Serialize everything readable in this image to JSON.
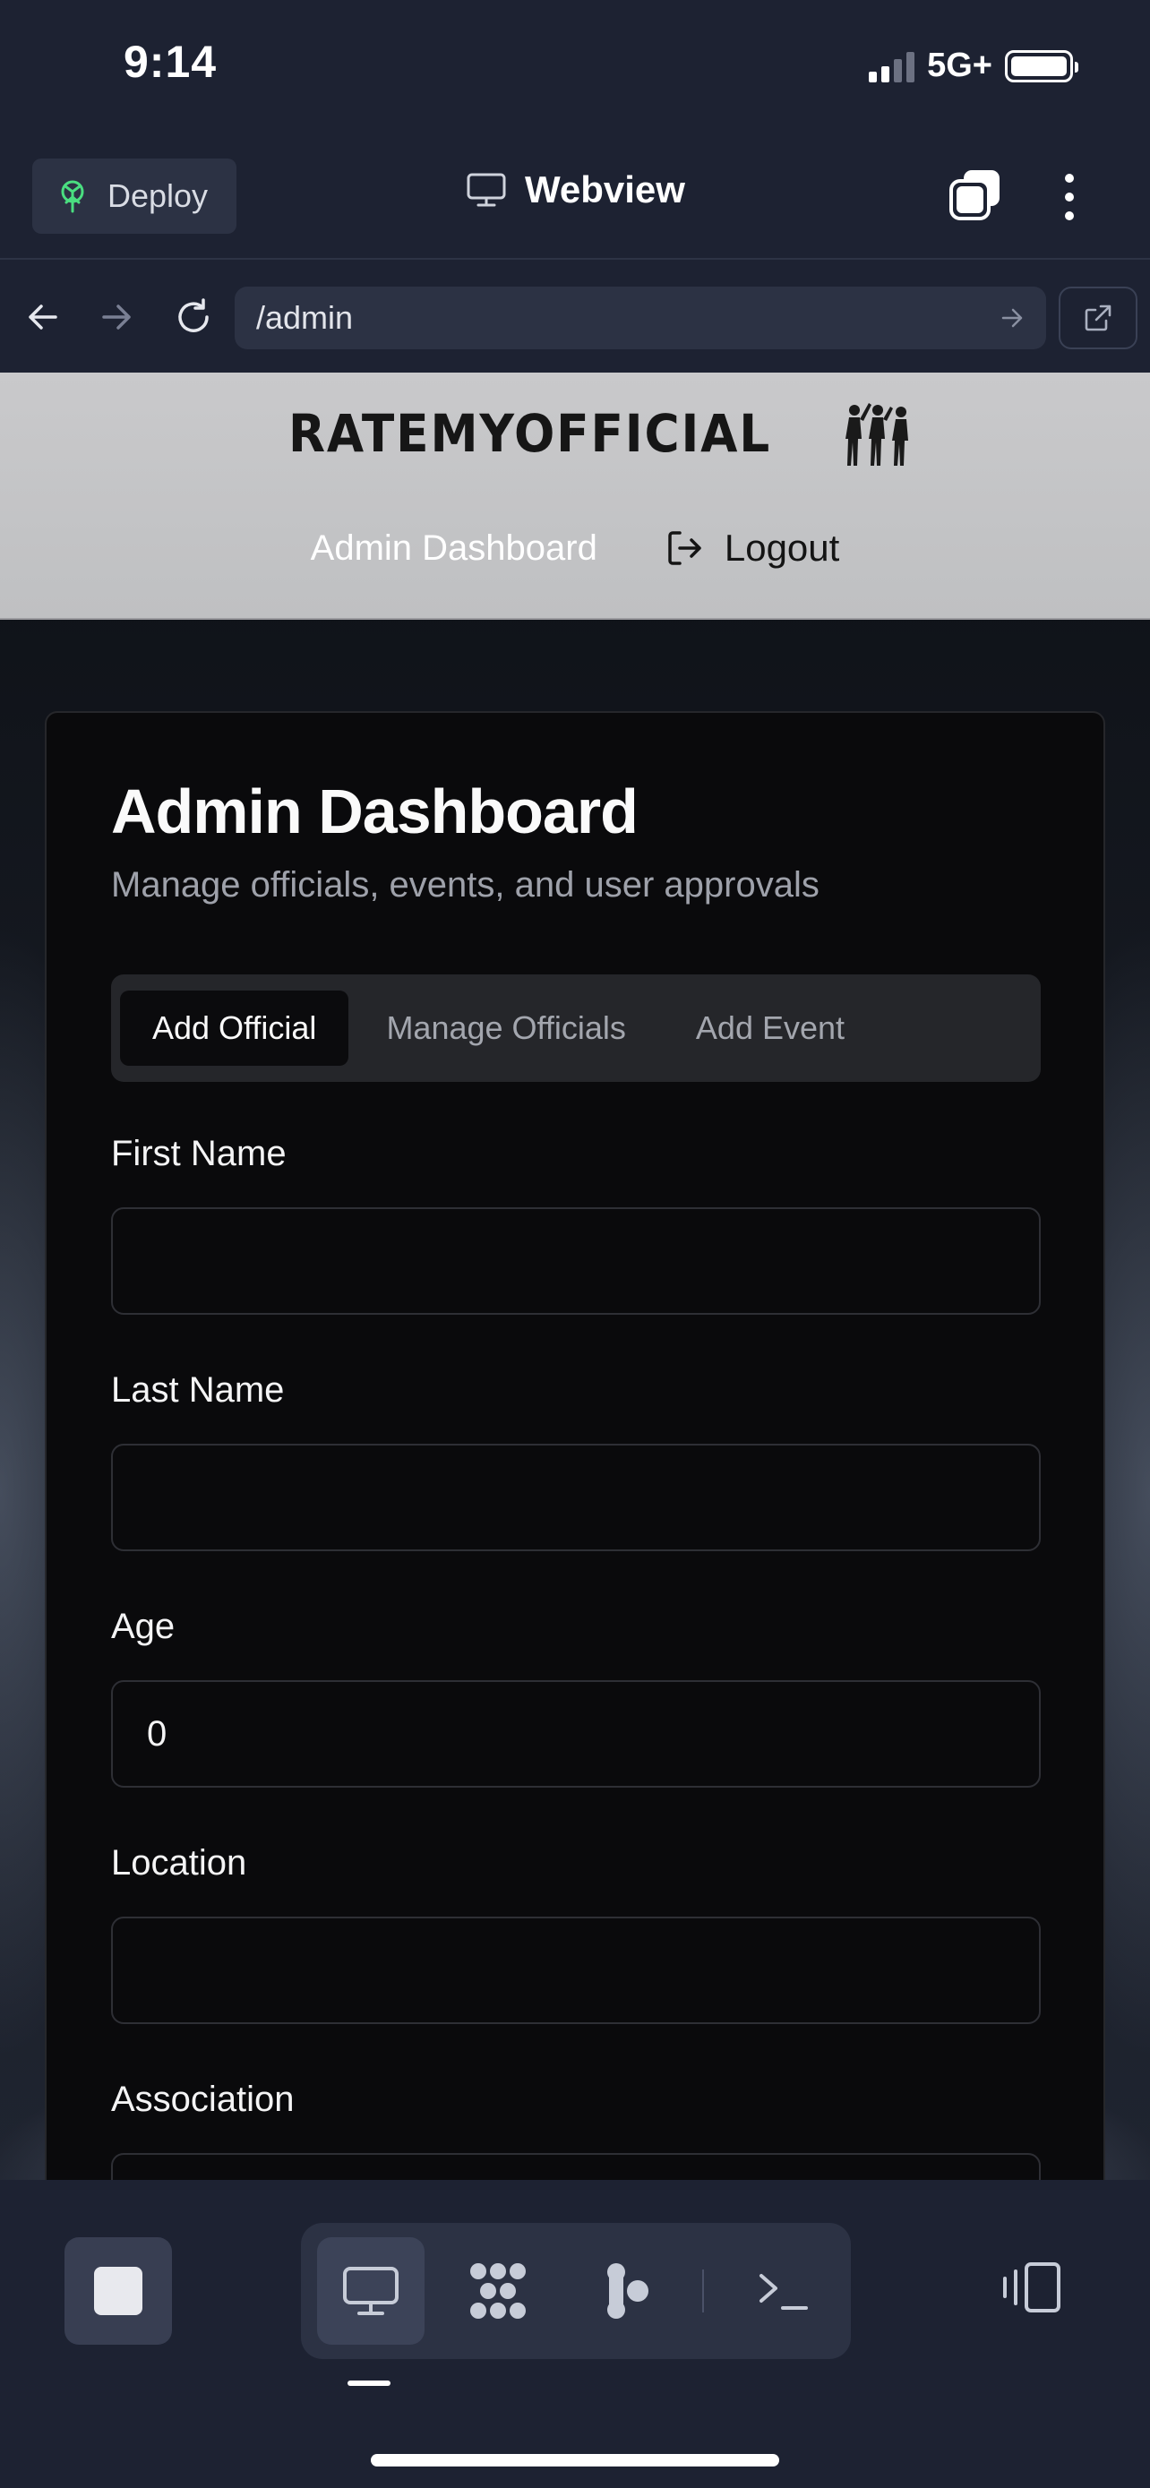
{
  "status_bar": {
    "time": "9:14",
    "network": "5G+"
  },
  "toolbar": {
    "deploy_label": "Deploy",
    "title": "Webview",
    "icons": [
      "deploy-icon",
      "monitor-icon",
      "tabs-icon",
      "more-vertical-icon"
    ]
  },
  "url_bar": {
    "url": "/admin",
    "icons": [
      "back-arrow-icon",
      "forward-arrow-icon",
      "reload-icon",
      "go-arrow-icon",
      "external-link-icon"
    ]
  },
  "site": {
    "logo_text": "RATEMYOFFICIAL",
    "nav": {
      "dashboard": "Admin Dashboard",
      "logout": "Logout"
    }
  },
  "card": {
    "title": "Admin Dashboard",
    "subtitle": "Manage officials, events, and user approvals",
    "tabs": [
      {
        "label": "Add Official",
        "active": true
      },
      {
        "label": "Manage Officials",
        "active": false
      },
      {
        "label": "Add Event",
        "active": false
      }
    ],
    "fields": [
      {
        "label": "First Name",
        "value": ""
      },
      {
        "label": "Last Name",
        "value": ""
      },
      {
        "label": "Age",
        "value": "0"
      },
      {
        "label": "Location",
        "value": ""
      },
      {
        "label": "Association",
        "value": ""
      }
    ]
  },
  "dock": {
    "items": [
      "stop-icon",
      "webview-icon",
      "workspace-icon",
      "agent-icon",
      "terminal-icon",
      "split-view-icon"
    ],
    "active": "webview-icon"
  },
  "colors": {
    "chrome_bg": "#1d2232",
    "chrome_surface": "#2c3244",
    "card_bg": "#0a0a0c",
    "header_bg": "#c9c9cb",
    "deploy_icon": "#4ade80"
  }
}
